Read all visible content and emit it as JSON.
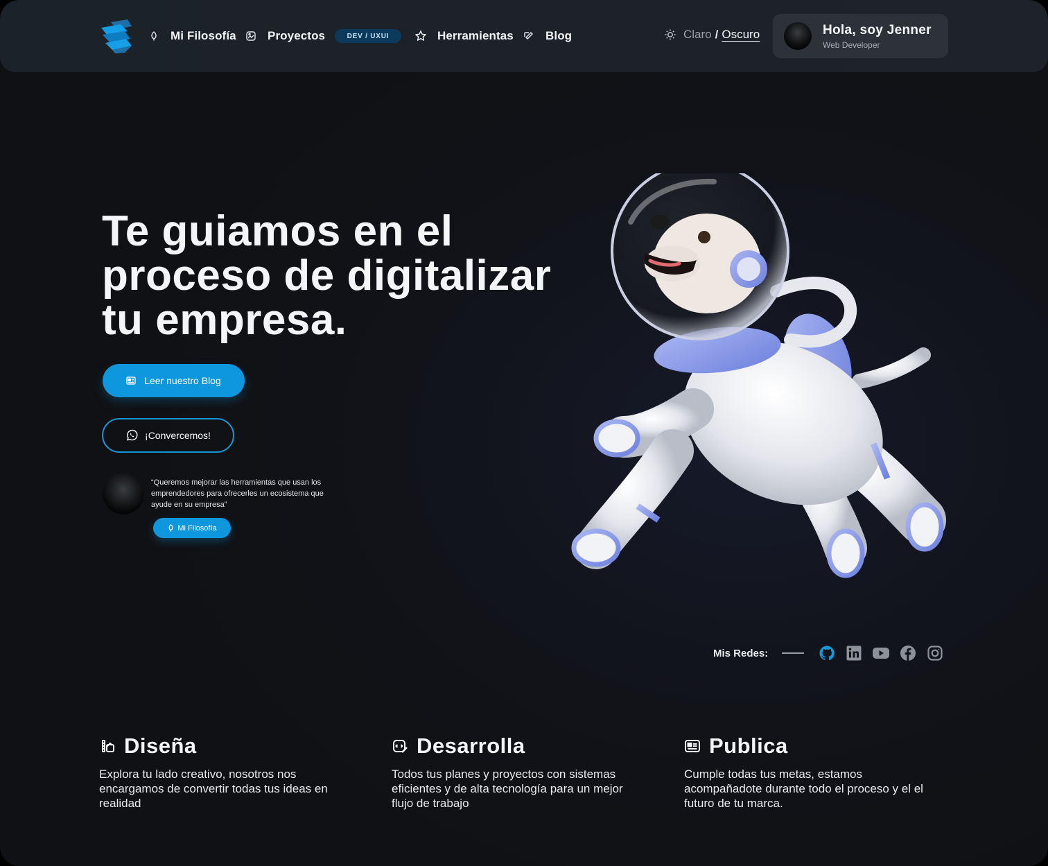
{
  "header": {
    "nav": [
      {
        "label": "Mi Filosofía",
        "icon": "leaf-icon"
      },
      {
        "label": "Proyectos",
        "icon": "gallery-icon",
        "badge": "DEV / UXUI"
      },
      {
        "label": "Herramientas",
        "icon": "star-icon"
      },
      {
        "label": "Blog",
        "icon": "edit-icon"
      }
    ],
    "theme": {
      "light": "Claro",
      "separator": "/",
      "dark": "Oscuro"
    },
    "profile": {
      "greeting": "Hola, soy Jenner",
      "role": "Web Developer"
    }
  },
  "hero": {
    "title_lines": [
      "Te guiamos en el",
      "proceso de digitalizar",
      "tu empresa."
    ],
    "blog_button": "Leer nuestro Blog",
    "chat_button": "¡Convercemos!",
    "quote_lines": [
      "“Queremos mejorar las herramientas que usan los",
      "emprendedores para ofrecerles un ecosistema que",
      "ayude en su empresa”"
    ],
    "philosophy_button": "Mi Filosofía"
  },
  "social": {
    "label": "Mis Redes:",
    "networks": [
      "github-icon",
      "linkedin-icon",
      "youtube-icon",
      "facebook-icon",
      "instagram-icon"
    ],
    "active_color": "#1796d6",
    "muted_color": "#8c9298"
  },
  "features": [
    {
      "title": "Diseña",
      "icon": "design-icon",
      "lines": [
        "Explora tu lado creativo, nosotros nos",
        "encargamos de convertir todas tus ideas en",
        "realidad"
      ]
    },
    {
      "title": "Desarrolla",
      "icon": "code-icon",
      "lines": [
        "Todos tus planes y proyectos con sistemas",
        "eficientes y de alta tecnología para un mejor",
        "flujo de trabajo"
      ]
    },
    {
      "title": "Publica",
      "icon": "newspaper-icon",
      "lines": [
        "Cumple todas tus metas, estamos",
        "acompañadote durante todo el proceso y el el",
        "futuro de tu marca."
      ]
    }
  ],
  "colors": {
    "accent": "#0e97dc",
    "background": "#111319",
    "header": "#1c2227"
  }
}
